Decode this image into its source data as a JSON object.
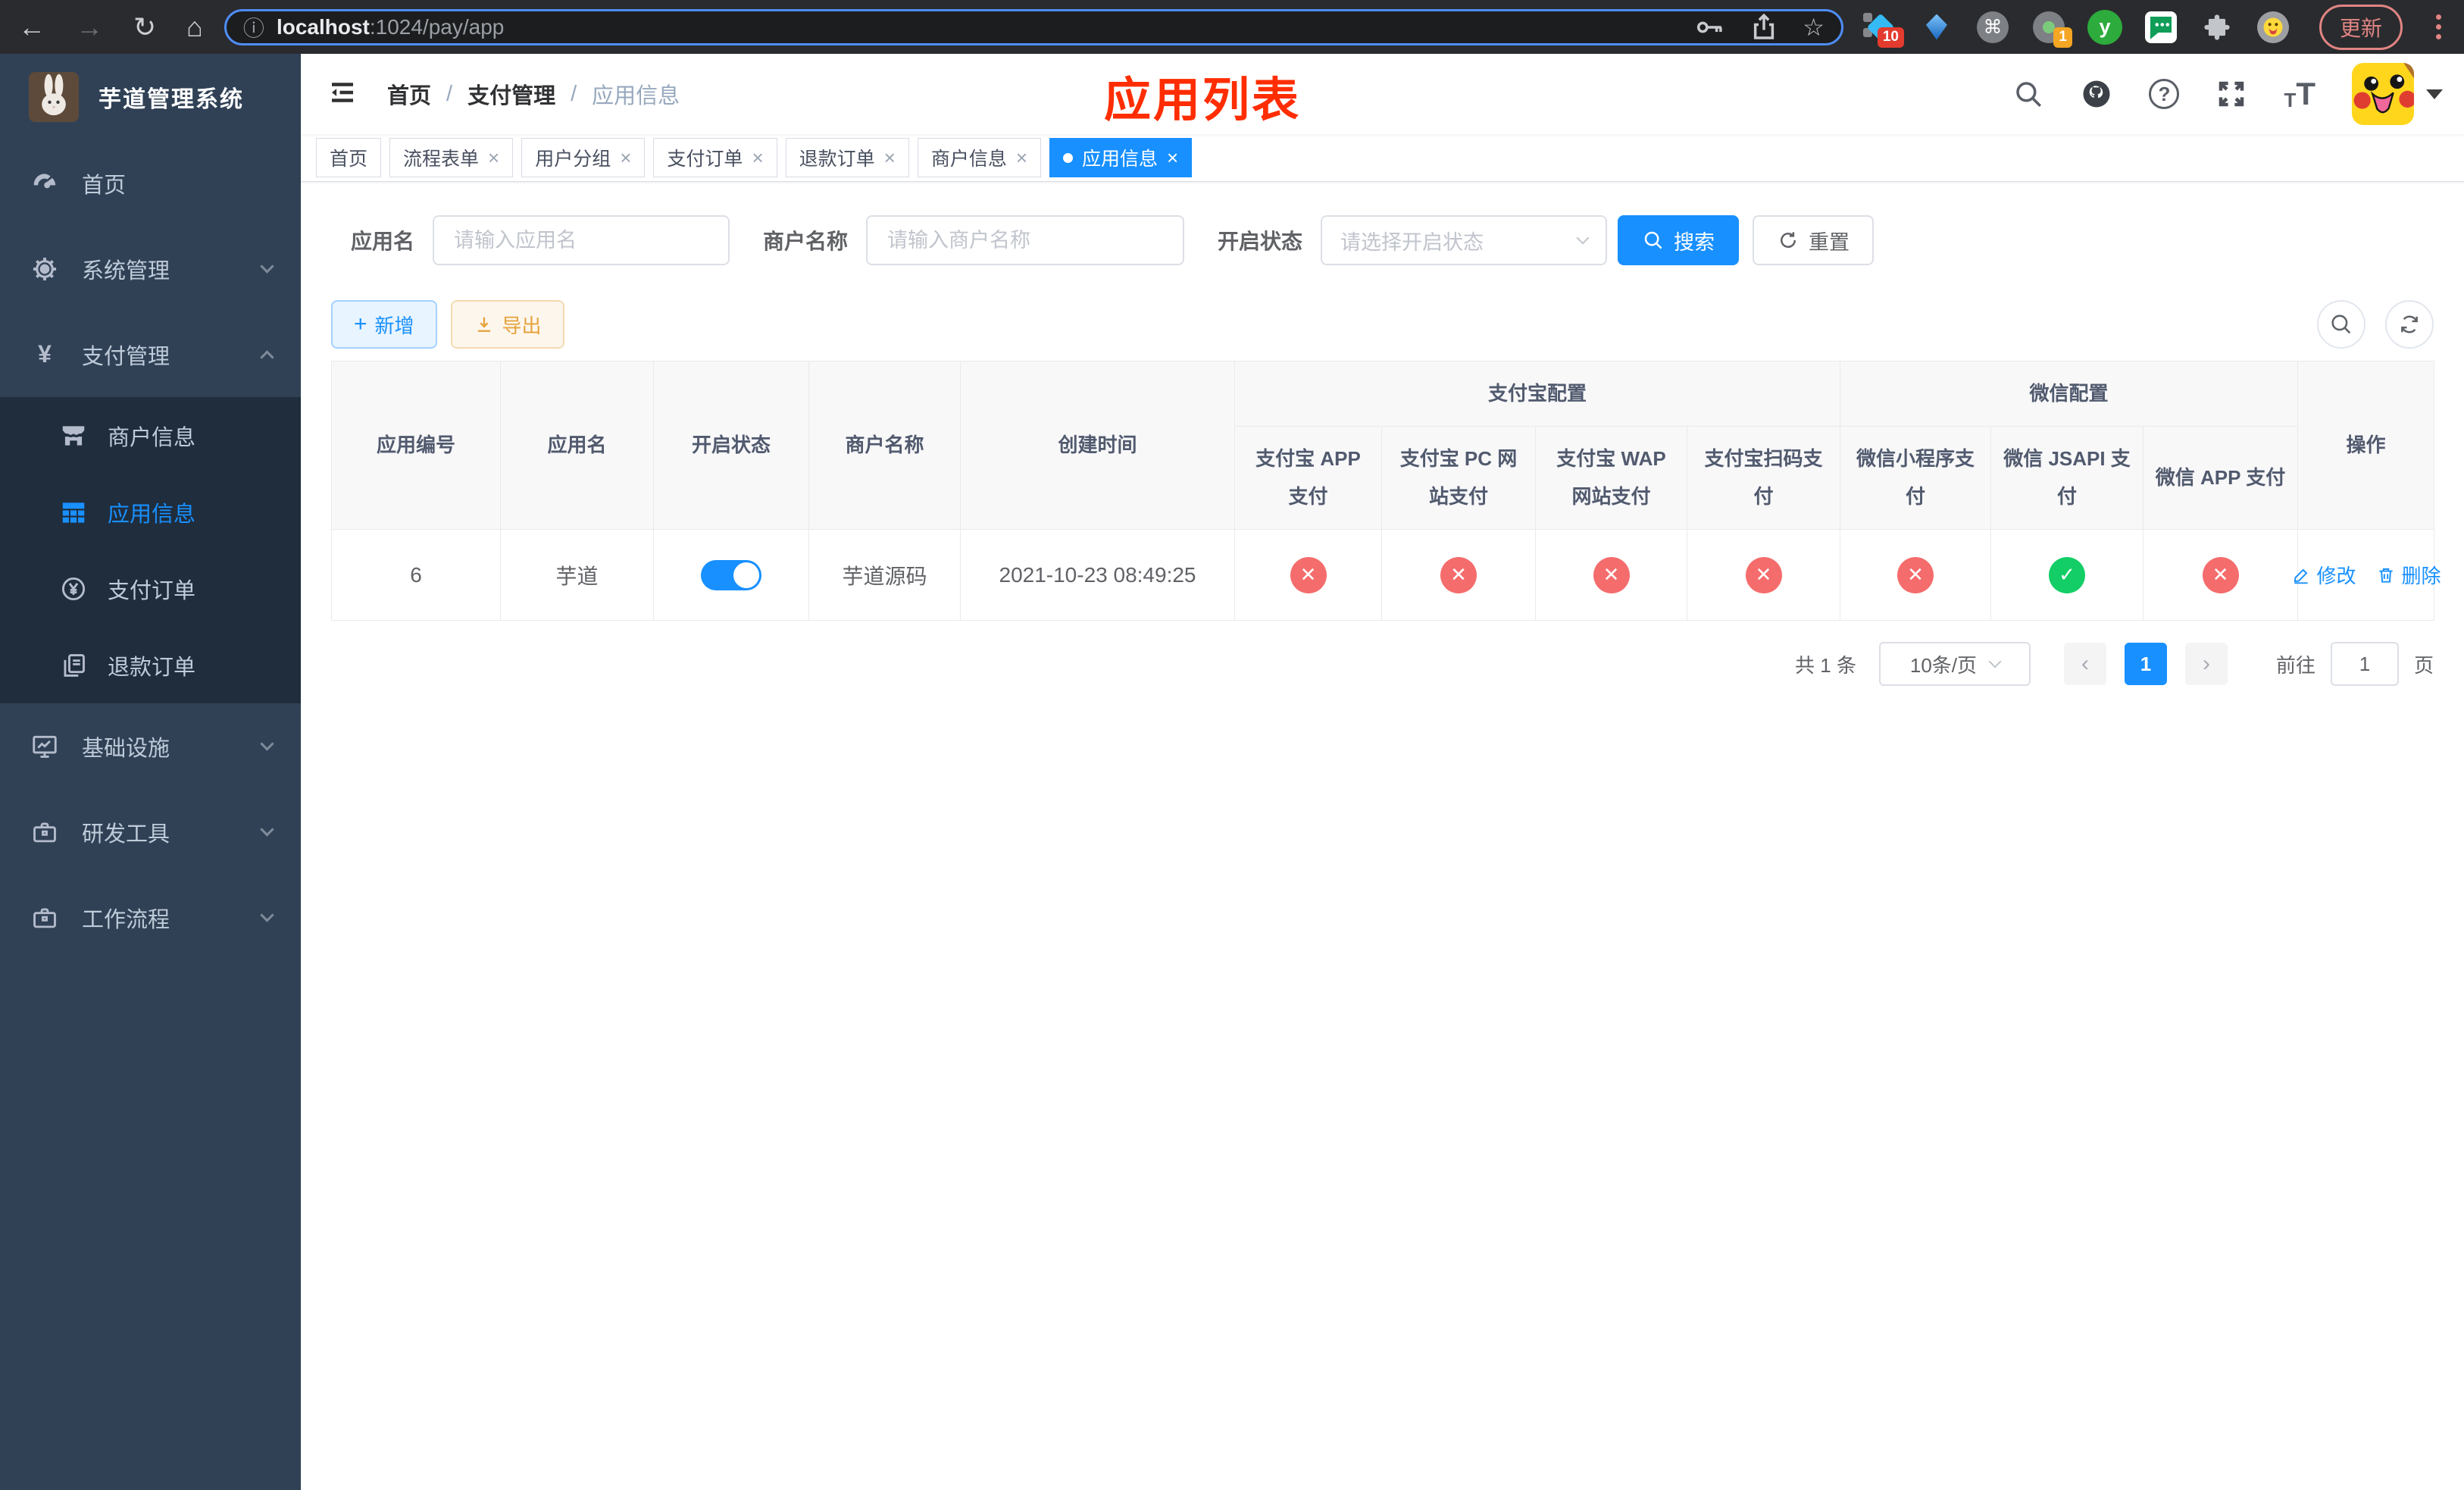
{
  "browser": {
    "url_host": "localhost",
    "url_rest": ":1024/pay/app",
    "update_label": "更新",
    "ext_badge_tabs": "10",
    "ext_badge_proxy": "1",
    "ext_y_label": "y"
  },
  "sidebar": {
    "title": "芋道管理系统",
    "items": [
      {
        "label": "首页"
      },
      {
        "label": "系统管理"
      },
      {
        "label": "支付管理"
      },
      {
        "label": "基础设施"
      },
      {
        "label": "研发工具"
      },
      {
        "label": "工作流程"
      }
    ],
    "payment_children": [
      {
        "label": "商户信息"
      },
      {
        "label": "应用信息"
      },
      {
        "label": "支付订单"
      },
      {
        "label": "退款订单"
      }
    ]
  },
  "header": {
    "breadcrumb": [
      "首页",
      "支付管理",
      "应用信息"
    ],
    "separator": "/",
    "annotation": "应用列表"
  },
  "tabs": [
    "首页",
    "流程表单",
    "用户分组",
    "支付订单",
    "退款订单",
    "商户信息",
    "应用信息"
  ],
  "filters": {
    "app_name_label": "应用名",
    "app_name_placeholder": "请输入应用名",
    "merchant_label": "商户名称",
    "merchant_placeholder": "请输入商户名称",
    "status_label": "开启状态",
    "status_placeholder": "请选择开启状态",
    "search_label": "搜索",
    "reset_label": "重置"
  },
  "toolbar": {
    "add_label": "新增",
    "export_label": "导出"
  },
  "table": {
    "columns_left": [
      "应用编号",
      "应用名",
      "开启状态",
      "商户名称",
      "创建时间"
    ],
    "group_alipay": "支付宝配置",
    "group_wechat": "微信配置",
    "pay_columns": [
      "支付宝 APP 支付",
      "支付宝 PC 网站支付",
      "支付宝 WAP 网站支付",
      "支付宝扫码支付",
      "微信小程序支付",
      "微信 JSAPI 支付",
      "微信 APP 支付"
    ],
    "col_actions": "操作",
    "row": {
      "id": "6",
      "name": "芋道",
      "status_on": true,
      "merchant": "芋道源码",
      "created_at": "2021-10-23 08:49:25",
      "pay_configs": [
        false,
        false,
        false,
        false,
        false,
        true,
        false
      ],
      "edit_label": "修改",
      "delete_label": "删除"
    }
  },
  "pagination": {
    "total": "共 1 条",
    "page_size": "10条/页",
    "current_page": "1",
    "goto_label": "前往",
    "goto_value": "1",
    "page_unit": "页"
  },
  "icons": {
    "back": "←",
    "forward": "→",
    "reload": "↻",
    "home": "⌂",
    "info": "ⓘ",
    "star": "☆",
    "cmd": "⌘",
    "question": "?",
    "close": "×",
    "check": "✓",
    "cross": "✕",
    "plus": "+",
    "prev": "‹",
    "next": "›",
    "yen": "¥",
    "t_small": "T",
    "t_big": "T"
  },
  "colors": {
    "primary": "#1890ff",
    "danger": "#f56c6c",
    "success": "#13ce66",
    "warning": "#e6a23c",
    "sidebar_bg": "#304156",
    "submenu_bg": "#1f2d3d",
    "annotation": "#ff2d00"
  }
}
